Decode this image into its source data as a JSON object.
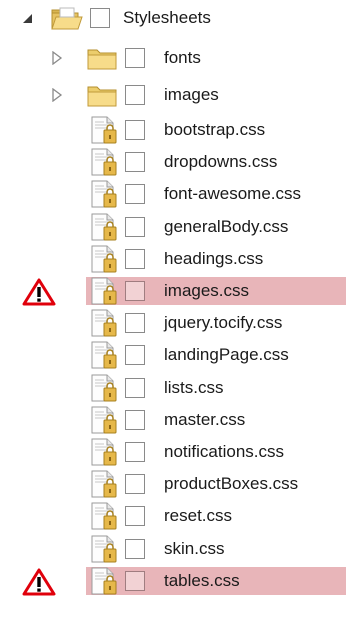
{
  "tree": {
    "root": {
      "label": "Stylesheets",
      "expanded": true
    },
    "folders": [
      {
        "label": "fonts",
        "expanded": false
      },
      {
        "label": "images",
        "expanded": false
      }
    ],
    "files": [
      {
        "label": "bootstrap.css",
        "warning": false
      },
      {
        "label": "dropdowns.css",
        "warning": false
      },
      {
        "label": "font-awesome.css",
        "warning": false
      },
      {
        "label": "generalBody.css",
        "warning": false
      },
      {
        "label": "headings.css",
        "warning": false
      },
      {
        "label": "images.css",
        "warning": true
      },
      {
        "label": "jquery.tocify.css",
        "warning": false
      },
      {
        "label": "landingPage.css",
        "warning": false
      },
      {
        "label": "lists.css",
        "warning": false
      },
      {
        "label": "master.css",
        "warning": false
      },
      {
        "label": "notifications.css",
        "warning": false
      },
      {
        "label": "productBoxes.css",
        "warning": false
      },
      {
        "label": "reset.css",
        "warning": false
      },
      {
        "label": "skin.css",
        "warning": false
      },
      {
        "label": "tables.css",
        "warning": true
      }
    ]
  },
  "colors": {
    "flag_highlight": "#e8b5b9",
    "warning_red": "#e0000b",
    "folder_yellow": "#f3d67a"
  },
  "icons": {
    "expanded": "expanded-triangle-icon",
    "collapsed": "collapsed-triangle-icon",
    "folder_open": "open-folder-icon",
    "folder": "folder-icon",
    "file": "css-file-icon",
    "warning": "warning-icon"
  }
}
